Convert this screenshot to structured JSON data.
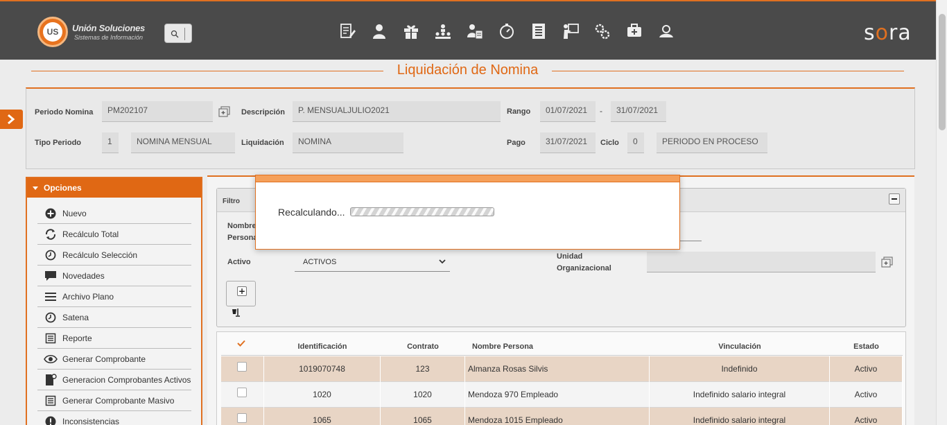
{
  "app": {
    "logo_mark": "US",
    "logo_title": "Unión Soluciones",
    "logo_subtitle": "Sistemas de Información",
    "brand_prefix": "s",
    "brand_dot": "o",
    "brand_suffix": "ra"
  },
  "nav_icons": [
    "edit-document-icon",
    "user-icon",
    "gift-icon",
    "org-chart-icon",
    "user-card-icon",
    "stopwatch-icon",
    "list-document-icon",
    "presentation-icon",
    "gears-icon",
    "medical-case-icon",
    "id-badge-icon"
  ],
  "page": {
    "title": "Liquidación de Nomina"
  },
  "header": {
    "periodo_label": "Periodo Nomina",
    "periodo_value": "PM202107",
    "descripcion_label": "Descripción",
    "descripcion_value": "P. MENSUALJULIO2021",
    "rango_label": "Rango",
    "rango_desde": "01/07/2021",
    "rango_sep": "-",
    "rango_hasta": "31/07/2021",
    "tipo_label": "Tipo Periodo",
    "tipo_code": "1",
    "tipo_value": "NOMINA MENSUAL",
    "liquidacion_label": "Liquidación",
    "liquidacion_value": "NOMINA",
    "pago_label": "Pago",
    "pago_value": "31/07/2021",
    "ciclo_label": "Ciclo",
    "ciclo_value": "0",
    "estado_value": "PERIODO EN PROCESO"
  },
  "options": {
    "title": "Opciones",
    "items": [
      {
        "label": "Nuevo",
        "icon": "plus-circle-icon"
      },
      {
        "label": "Recálculo Total",
        "icon": "refresh-icon"
      },
      {
        "label": "Recálculo Selección",
        "icon": "clock-icon"
      },
      {
        "label": "Novedades",
        "icon": "comment-icon"
      },
      {
        "label": "Archivo Plano",
        "icon": "lines-icon"
      },
      {
        "label": "Satena",
        "icon": "clock-icon"
      },
      {
        "label": "Reporte",
        "icon": "report-icon"
      },
      {
        "label": "Generar Comprobante",
        "icon": "eye-icon"
      },
      {
        "label": "Generacion Comprobantes Activos",
        "icon": "file-gear-icon"
      },
      {
        "label": "Generar Comprobante Masivo",
        "icon": "report-icon"
      },
      {
        "label": "Inconsistencias",
        "icon": "alert-icon"
      }
    ]
  },
  "filter": {
    "title": "Filtro",
    "nombre_label_1": "Nombre",
    "nombre_label_2": "Persona",
    "activo_label": "Activo",
    "activo_value": "ACTIVOS",
    "unidad_label_1": "Unidad",
    "unidad_label_2": "Organizacional"
  },
  "grid": {
    "columns": [
      "Identificación",
      "Contrato",
      "Nombre Persona",
      "Vinculación",
      "Estado"
    ],
    "rows": [
      {
        "id": "1019070748",
        "contrato": "123",
        "nombre": "Almanza Rosas Silvis",
        "vinculacion": "Indefinido",
        "estado": "Activo"
      },
      {
        "id": "1020",
        "contrato": "1020",
        "nombre": "Mendoza 970 Empleado",
        "vinculacion": "Indefinido salario integral",
        "estado": "Activo"
      },
      {
        "id": "1065",
        "contrato": "1065",
        "nombre": "Mendoza 1015 Empleado",
        "vinculacion": "Indefinido salario integral",
        "estado": "Activo"
      }
    ]
  },
  "modal": {
    "message": "Recalculando..."
  },
  "colors": {
    "accent": "#e07020",
    "topbar": "#4a4a4a",
    "row_alt": "#e8d5c5"
  }
}
